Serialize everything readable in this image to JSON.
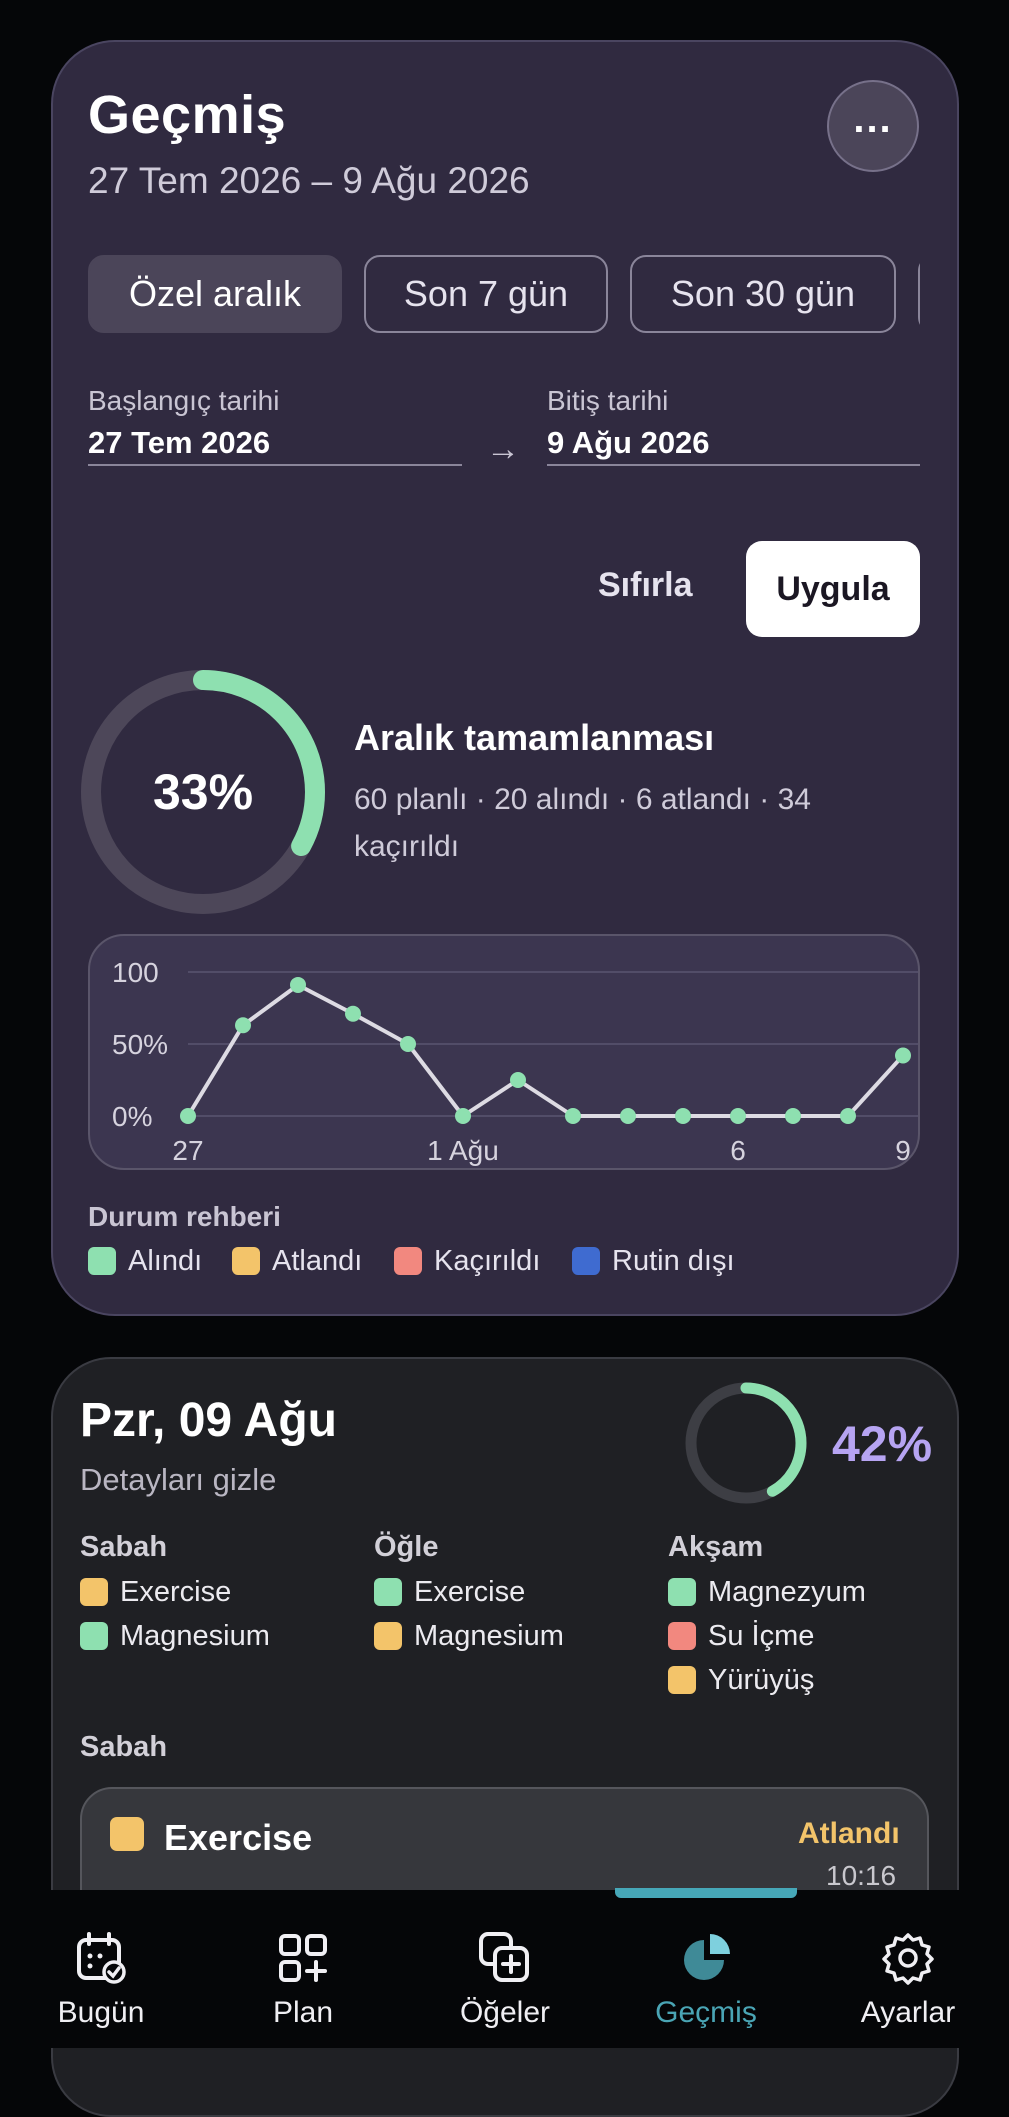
{
  "header": {
    "title": "Geçmiş",
    "date_range": "27 Tem 2026 – 9 Ağu 2026",
    "more_label": "..."
  },
  "range_pills": [
    {
      "label": "Özel aralık",
      "active": true
    },
    {
      "label": "Son 7 gün",
      "active": false
    },
    {
      "label": "Son 30 gün",
      "active": false
    }
  ],
  "date_fields": {
    "start_label": "Başlangıç tarihi",
    "start_value": "27 Tem 2026",
    "end_label": "Bitiş tarihi",
    "end_value": "9 Ağu 2026",
    "arrow": "→"
  },
  "actions": {
    "reset": "Sıfırla",
    "apply": "Uygula"
  },
  "summary": {
    "percent_label": "33%",
    "percent": 33,
    "title": "Aralık tamamlanması",
    "detail": "60 planlı · 20 alındı · 6 atlandı · 34 kaçırıldı"
  },
  "chart_data": {
    "type": "line",
    "x": [
      "27 Tem",
      "28 Tem",
      "29 Tem",
      "30 Tem",
      "31 Tem",
      "1 Ağu",
      "2 Ağu",
      "3 Ağu",
      "4 Ağu",
      "5 Ağu",
      "6 Ağu",
      "7 Ağu",
      "8 Ağu",
      "9 Ağu"
    ],
    "values": [
      0,
      63,
      91,
      71,
      50,
      0,
      25,
      0,
      0,
      0,
      0,
      0,
      0,
      42
    ],
    "y_ticks": [
      "100",
      "50%",
      "0%"
    ],
    "x_ticks": [
      {
        "index": 0,
        "label": "27"
      },
      {
        "index": 5,
        "label": "1 Ağu"
      },
      {
        "index": 10,
        "label": "6"
      },
      {
        "index": 13,
        "label": "9"
      }
    ],
    "ylim": [
      0,
      100
    ],
    "grid": true,
    "line_color": "#dddbe3",
    "point_color": "#8ee0b0"
  },
  "legend": {
    "title": "Durum rehberi",
    "items": [
      {
        "label": "Alındı",
        "color": "#8ee0b0"
      },
      {
        "label": "Atlandı",
        "color": "#f3c46a"
      },
      {
        "label": "Kaçırıldı",
        "color": "#f2887f"
      },
      {
        "label": "Rutin dışı",
        "color": "#3f6bd0"
      }
    ]
  },
  "day": {
    "title": "Pzr, 09 Ağu",
    "toggle": "Detayları gizle",
    "percent_label": "42%",
    "percent": 42,
    "columns": [
      {
        "heading": "Sabah",
        "items": [
          {
            "label": "Exercise",
            "color": "#f3c46a"
          },
          {
            "label": "Magnesium",
            "color": "#8ee0b0"
          }
        ]
      },
      {
        "heading": "Öğle",
        "items": [
          {
            "label": "Exercise",
            "color": "#8ee0b0"
          },
          {
            "label": "Magnesium",
            "color": "#f3c46a"
          }
        ]
      },
      {
        "heading": "Akşam",
        "items": [
          {
            "label": "Magnezyum",
            "color": "#8ee0b0"
          },
          {
            "label": "Su İçme",
            "color": "#f2887f"
          },
          {
            "label": "Yürüyüş",
            "color": "#f3c46a"
          }
        ]
      }
    ],
    "section_heading": "Sabah",
    "entry": {
      "name": "Exercise",
      "status": "Atlandı",
      "time": "10:16",
      "color": "#f3c46a"
    }
  },
  "nav": [
    {
      "label": "Bugün",
      "icon": "calendar-check-icon"
    },
    {
      "label": "Plan",
      "icon": "grid-plus-icon"
    },
    {
      "label": "Öğeler",
      "icon": "add-copy-icon"
    },
    {
      "label": "Geçmiş",
      "icon": "pie-chart-icon",
      "active": true
    },
    {
      "label": "Ayarlar",
      "icon": "gear-icon"
    }
  ]
}
